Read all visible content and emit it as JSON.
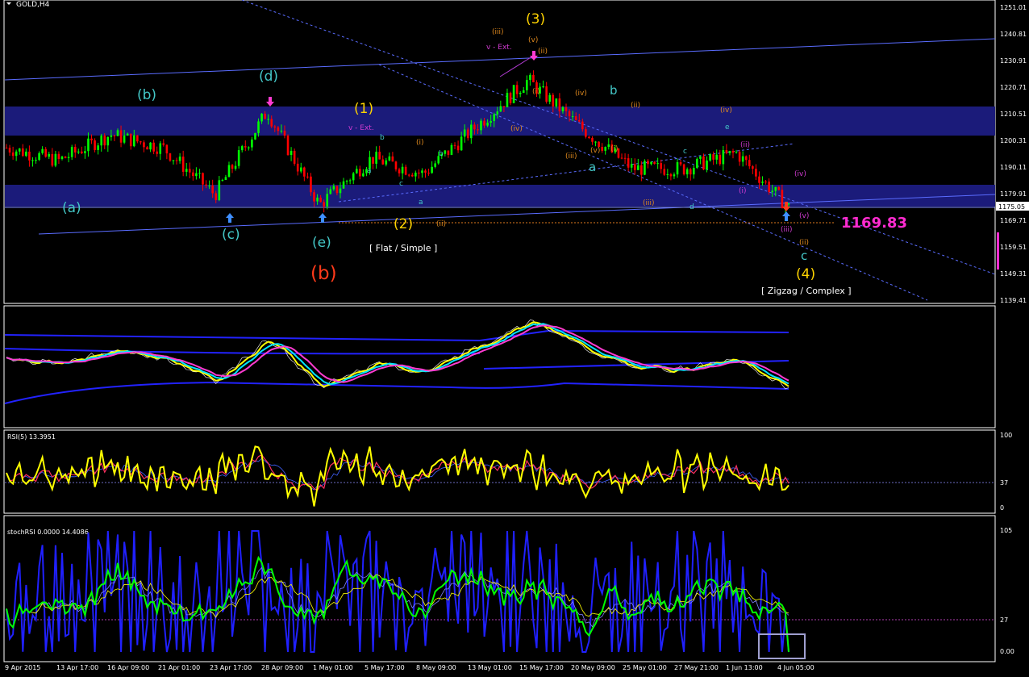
{
  "window": {
    "title": "GOLD,H4"
  },
  "colors": {
    "background": "#000000",
    "axis_text": "#ffffff",
    "bull_candle": "#00ff00",
    "bear_candle": "#ff0000",
    "zone": "#1b1b7a",
    "channel_line": "#5a6cff",
    "target_price": "#ff2bd0",
    "cyan_labels": "#44c8c8",
    "yellow_labels": "#ffd400",
    "orange_labels": "#e08a1e",
    "magenta_labels": "#d13bd1",
    "red_label": "#ff3a1a",
    "rsi_line": "#ffff00",
    "stoch_line": "#00ff00"
  },
  "price_axis": {
    "ticks": [
      "1251.01",
      "1240.81",
      "1230.91",
      "1220.71",
      "1210.51",
      "1200.31",
      "1190.11",
      "1179.91",
      "1169.71",
      "1159.51",
      "1149.31",
      "1139.41"
    ],
    "current_price": "1175.05"
  },
  "time_axis": {
    "labels": [
      "9 Apr 2015",
      "13 Apr 17:00",
      "16 Apr 09:00",
      "21 Apr 01:00",
      "23 Apr 17:00",
      "28 Apr 09:00",
      "1 May 01:00",
      "5 May 17:00",
      "8 May 09:00",
      "13 May 01:00",
      "15 May 17:00",
      "20 May 09:00",
      "25 May 01:00",
      "27 May 21:00",
      "1 Jun 13:00",
      "4 Jun 05:00"
    ]
  },
  "annotations": {
    "target_price": "1169.83",
    "flat_note": "[ Flat / Simple ]",
    "zigzag_note": "[ Zigzag / Complex ]",
    "primary_waves": [
      {
        "key": "w1",
        "text": "(1)"
      },
      {
        "key": "w2",
        "text": "(2)"
      },
      {
        "key": "w3",
        "text": "(3)"
      },
      {
        "key": "w4",
        "text": "(4)"
      }
    ],
    "intermediate_waves": [
      {
        "key": "a",
        "text": "(a)"
      },
      {
        "key": "b",
        "text": "(b)"
      },
      {
        "key": "c",
        "text": "(c)"
      },
      {
        "key": "d",
        "text": "(d)"
      },
      {
        "key": "e",
        "text": "(e)"
      },
      {
        "key": "B",
        "text": "(b)"
      }
    ],
    "minor_labels": [
      {
        "key": "ext1",
        "text": "v - Ext."
      },
      {
        "key": "ext2",
        "text": "v - Ext."
      },
      {
        "key": "a1",
        "text": "a"
      },
      {
        "key": "b1",
        "text": "b"
      },
      {
        "key": "c1",
        "text": "c"
      },
      {
        "key": "iii1",
        "text": "(iii)"
      },
      {
        "key": "v1",
        "text": "(v)"
      },
      {
        "key": "ii1",
        "text": "(ii)"
      },
      {
        "key": "i1",
        "text": "(i)"
      },
      {
        "key": "iv1",
        "text": "(iv)"
      },
      {
        "key": "iv2",
        "text": "(iv)"
      },
      {
        "key": "iii2",
        "text": "(iii)"
      },
      {
        "key": "v2",
        "text": "(v)"
      },
      {
        "key": "ii2",
        "text": "(ii)"
      },
      {
        "key": "i2",
        "text": "(i)"
      },
      {
        "key": "iv3",
        "text": "(iv)"
      },
      {
        "key": "iii3",
        "text": "(iii)"
      },
      {
        "key": "ii3",
        "text": "(ii)"
      },
      {
        "key": "i3",
        "text": "(i)"
      },
      {
        "key": "iv4",
        "text": "(iv)"
      },
      {
        "key": "iii4",
        "text": "(iii)"
      },
      {
        "key": "v4",
        "text": "(v)"
      },
      {
        "key": "i4",
        "text": "(i)"
      },
      {
        "key": "ii4",
        "text": "(ii)"
      },
      {
        "key": "ii5",
        "text": "(ii)"
      },
      {
        "key": "s_b",
        "text": "b"
      },
      {
        "key": "s_a",
        "text": "a"
      },
      {
        "key": "s_c",
        "text": "c"
      },
      {
        "key": "s_d",
        "text": "d"
      },
      {
        "key": "s_e",
        "text": "e"
      },
      {
        "key": "s_b2",
        "text": "b"
      },
      {
        "key": "s_a2",
        "text": "a"
      },
      {
        "key": "s_c2",
        "text": "c"
      }
    ]
  },
  "rsi_panel": {
    "title": "RSI(5) 13.3951",
    "levels": [
      "100",
      "37",
      "0"
    ]
  },
  "stoch_panel": {
    "title": "stochRSI 0.0000 14.4086",
    "levels": [
      "105",
      "27",
      "0.00"
    ]
  },
  "chart_data": {
    "type": "candlestick",
    "symbol": "GOLD",
    "timeframe": "H4",
    "ylim": [
      1139.41,
      1251.01
    ],
    "x": [
      "9 Apr 2015",
      "13 Apr 17:00",
      "16 Apr 09:00",
      "21 Apr 01:00",
      "23 Apr 17:00",
      "28 Apr 09:00",
      "1 May 01:00",
      "5 May 17:00",
      "8 May 09:00",
      "13 May 01:00",
      "15 May 17:00",
      "20 May 09:00",
      "25 May 01:00",
      "27 May 21:00",
      "1 Jun 13:00",
      "4 Jun 05:00"
    ],
    "close_approx": [
      1198,
      1193,
      1203,
      1198,
      1180,
      1212,
      1176,
      1194,
      1188,
      1206,
      1224,
      1206,
      1190,
      1190,
      1196,
      1175
    ],
    "last_price": 1175.05,
    "target": 1169.83,
    "indicators": [
      {
        "name": "RSI(5)",
        "value": 13.3951,
        "levels": [
          0,
          37,
          100
        ]
      },
      {
        "name": "stochRSI",
        "values": [
          0.0,
          14.4086
        ],
        "levels": [
          0,
          27,
          105
        ]
      }
    ]
  }
}
